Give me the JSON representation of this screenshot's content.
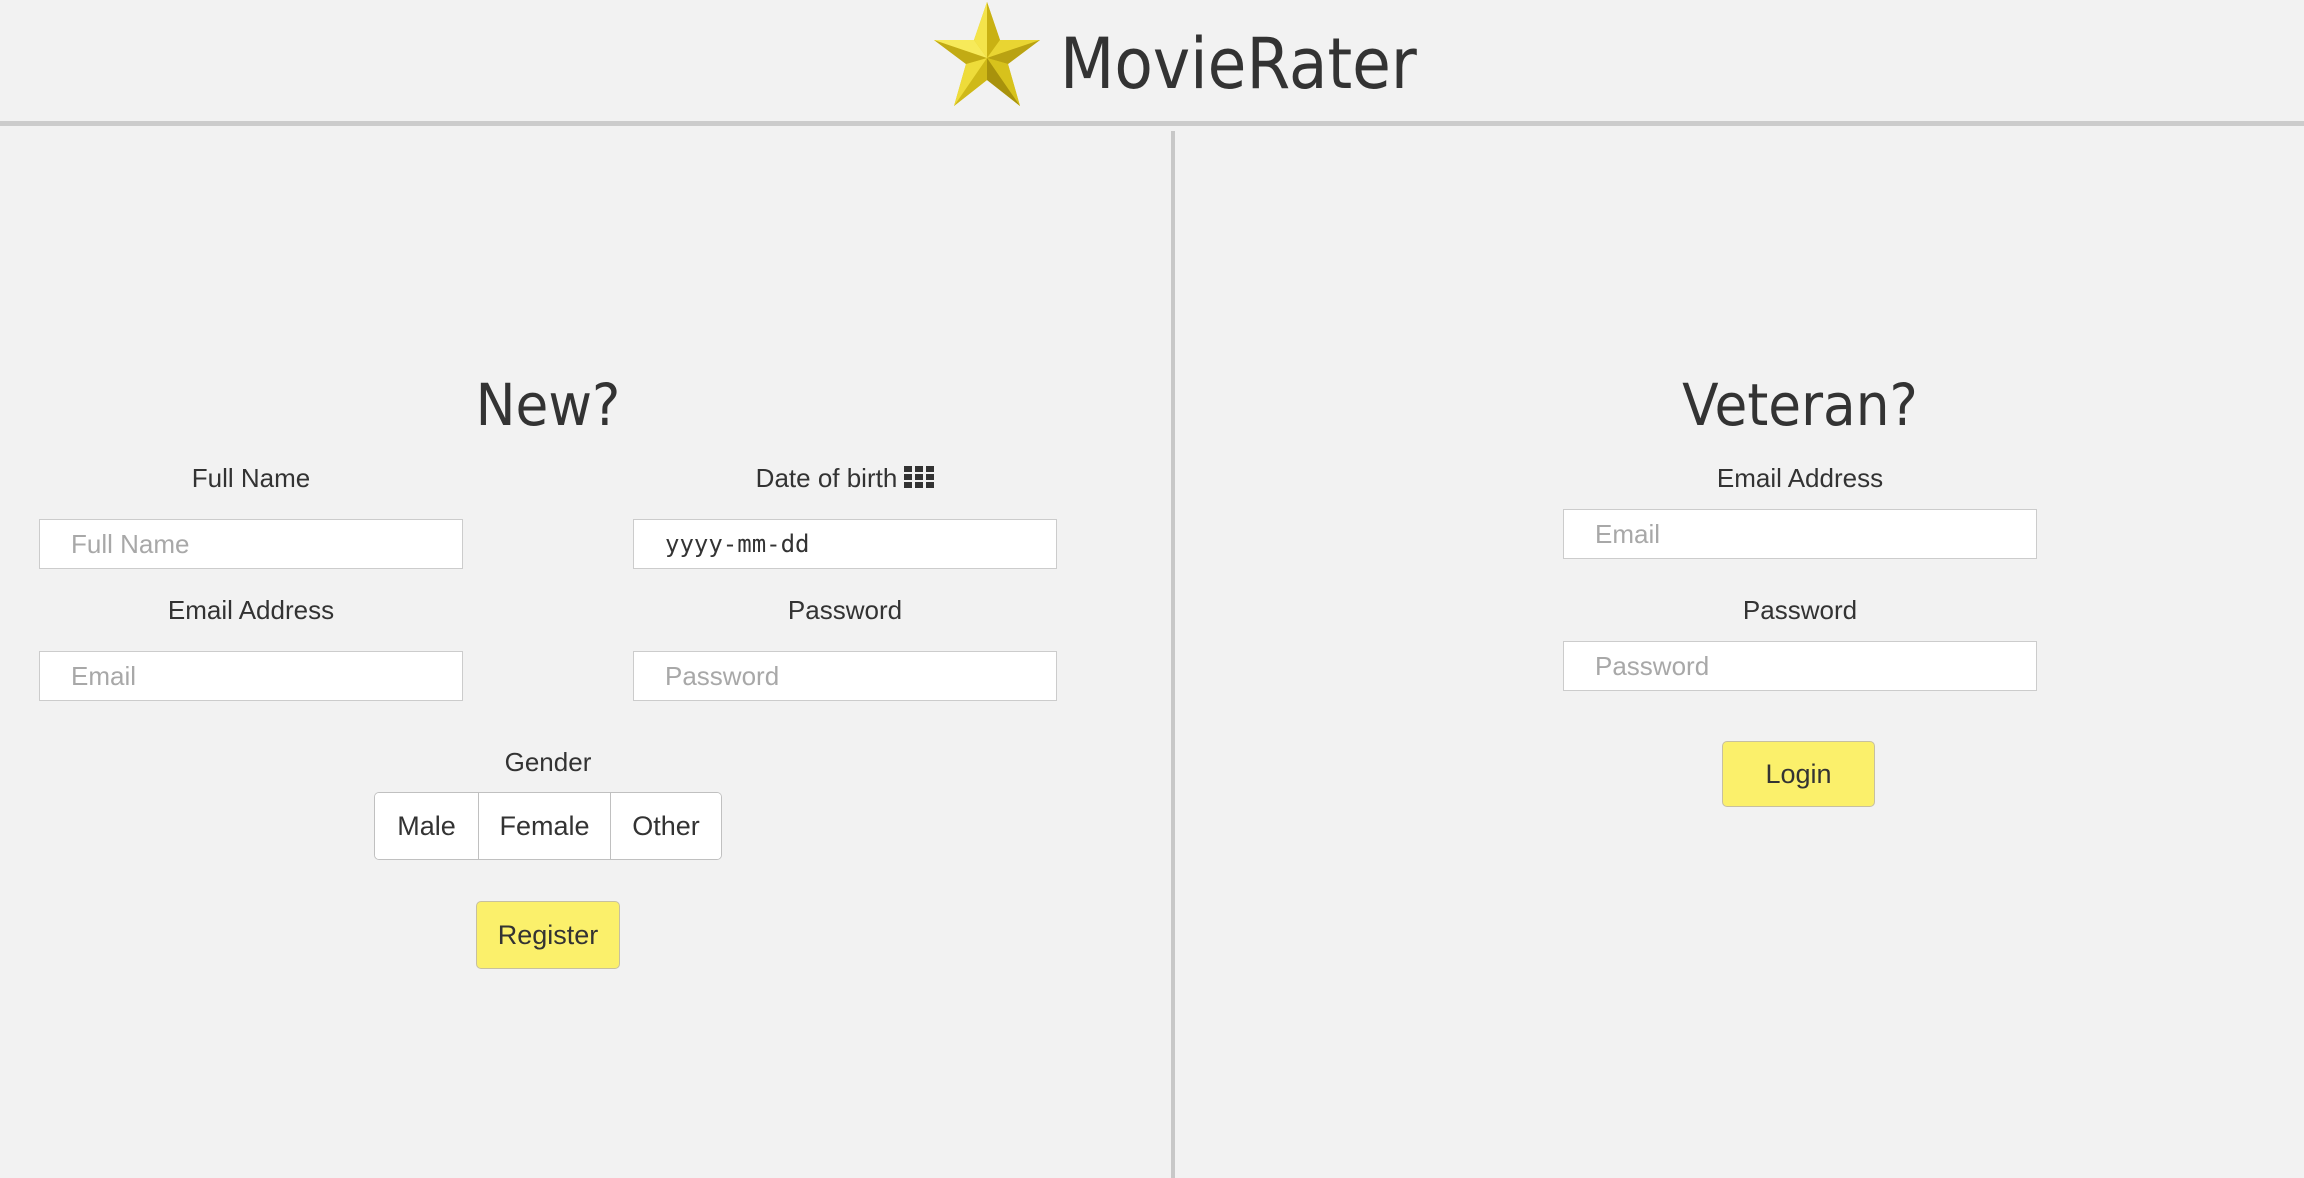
{
  "header": {
    "app_title": "MovieRater",
    "logo_icon": "star-icon"
  },
  "register": {
    "title": "New?",
    "full_name": {
      "label": "Full Name",
      "placeholder": "Full Name",
      "value": ""
    },
    "dob": {
      "label": "Date of birth",
      "value": "yyyy-mm-dd",
      "icon": "calendar-icon"
    },
    "email": {
      "label": "Email Address",
      "placeholder": "Email",
      "value": ""
    },
    "password": {
      "label": "Password",
      "placeholder": "Password",
      "value": ""
    },
    "gender": {
      "label": "Gender",
      "options": [
        "Male",
        "Female",
        "Other"
      ]
    },
    "submit_label": "Register"
  },
  "login": {
    "title": "Veteran?",
    "email": {
      "label": "Email Address",
      "placeholder": "Email",
      "value": ""
    },
    "password": {
      "label": "Password",
      "placeholder": "Password",
      "value": ""
    },
    "submit_label": "Login"
  },
  "colors": {
    "background": "#f2f2f2",
    "accent_button": "#fbf06b",
    "star_gold": "#e8d22a",
    "divider": "#cccccc",
    "text": "#333333",
    "placeholder": "#a8a8a8"
  }
}
